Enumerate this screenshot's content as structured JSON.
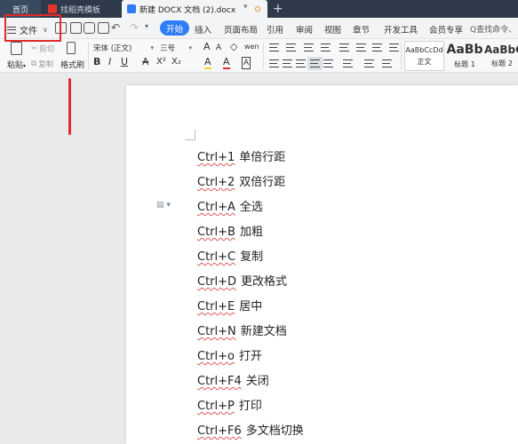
{
  "tabs": {
    "home": "首页",
    "template": "找稻壳模板",
    "document": "新建 DOCX 文档 (2).docx",
    "more": "▾",
    "add": "+"
  },
  "menu": {
    "file": "文件",
    "file_chevron": "∨",
    "undo": "↶",
    "redo": "↷",
    "more": "▾",
    "tabs": [
      "开始",
      "插入",
      "页面布局",
      "引用",
      "审阅",
      "视图",
      "章节",
      "开发工具",
      "会员专享"
    ],
    "search": "Q查找命令、"
  },
  "ribbon": {
    "paste": "粘贴",
    "paste_arrow": "▾",
    "cut": "剪切",
    "copy": "复制",
    "format_painter": "格式刷",
    "font": "宋体 (正文)",
    "font_size": "三号",
    "dropdown": "▾",
    "grow": "A",
    "shrink": "A",
    "clear": "◇",
    "phonetic": "wen",
    "bold": "B",
    "italic": "I",
    "underline": "U",
    "strike": "A",
    "superscript": "X²",
    "subscript": "X₂",
    "highlight": "A",
    "font_color": "A",
    "char_border": "A",
    "styles": {
      "normal_preview": "AaBbCcDd",
      "normal_label": "正文",
      "h1_preview": "AaBb",
      "h1_label": "标题 1",
      "h2_preview": "AaBbC",
      "h2_label": "标题 2"
    }
  },
  "accent_color": "#2f7df6",
  "annotation_color": "#e12a2a",
  "document": {
    "lines": [
      {
        "key": "Ctrl+1",
        "desc": "单倍行距"
      },
      {
        "key": "Ctrl+2",
        "desc": "双倍行距"
      },
      {
        "key": "Ctrl+A",
        "desc": "全选"
      },
      {
        "key": "Ctrl+B",
        "desc": "加粗"
      },
      {
        "key": "Ctrl+C",
        "desc": "复制"
      },
      {
        "key": "Ctrl+D",
        "desc": "更改格式"
      },
      {
        "key": "Ctrl+E",
        "desc": "居中"
      },
      {
        "key": "Ctrl+N",
        "desc": "新建文档"
      },
      {
        "key": "Ctrl+o",
        "desc": "打开"
      },
      {
        "key": "Ctrl+F4",
        "desc": "关闭"
      },
      {
        "key": "Ctrl+P",
        "desc": "打印"
      },
      {
        "key": "Ctrl+F6",
        "desc": "多文档切换"
      }
    ]
  }
}
